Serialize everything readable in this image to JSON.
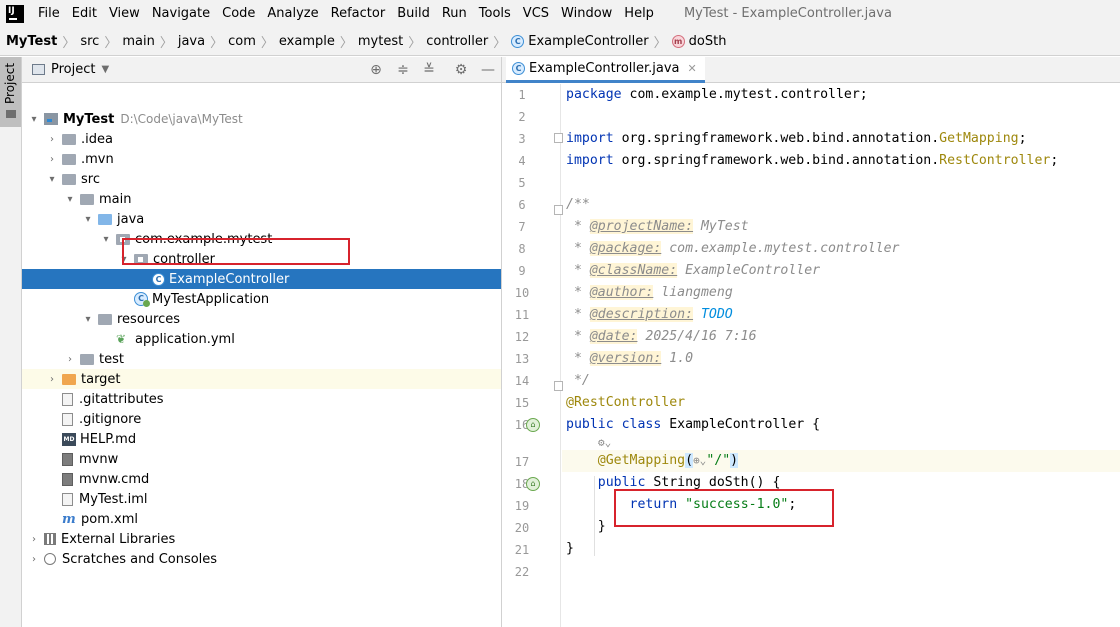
{
  "menubar": {
    "logo_text": "IJ",
    "items": [
      "File",
      "Edit",
      "View",
      "Navigate",
      "Code",
      "Analyze",
      "Refactor",
      "Build",
      "Run",
      "Tools",
      "VCS",
      "Window",
      "Help"
    ],
    "window_title": "MyTest - ExampleController.java"
  },
  "breadcrumbs": [
    "MyTest",
    "src",
    "main",
    "java",
    "com",
    "example",
    "mytest",
    "controller",
    "ExampleController",
    "doSth"
  ],
  "project_panel": {
    "title": "Project",
    "tree": [
      {
        "label": "MyTest",
        "hint": "D:\\Code\\java\\MyTest"
      },
      {
        "label": ".idea"
      },
      {
        "label": ".mvn"
      },
      {
        "label": "src"
      },
      {
        "label": "main"
      },
      {
        "label": "java"
      },
      {
        "label": "com.example.mytest"
      },
      {
        "label": "controller"
      },
      {
        "label": "ExampleController"
      },
      {
        "label": "MyTestApplication"
      },
      {
        "label": "resources"
      },
      {
        "label": "application.yml"
      },
      {
        "label": "test"
      },
      {
        "label": "target"
      },
      {
        "label": ".gitattributes"
      },
      {
        "label": ".gitignore"
      },
      {
        "label": "HELP.md"
      },
      {
        "label": "mvnw"
      },
      {
        "label": "mvnw.cmd"
      },
      {
        "label": "MyTest.iml"
      },
      {
        "label": "pom.xml"
      },
      {
        "label": "External Libraries"
      },
      {
        "label": "Scratches and Consoles"
      }
    ]
  },
  "editor": {
    "tab_label": "ExampleController.java",
    "line_numbers": [
      "1",
      "2",
      "3",
      "4",
      "5",
      "6",
      "7",
      "8",
      "9",
      "10",
      "11",
      "12",
      "13",
      "14",
      "15",
      "16",
      "17",
      "18",
      "19",
      "20",
      "21",
      "22"
    ],
    "code": {
      "l1_kw": "package",
      "l1_rest": " com.example.mytest.controller;",
      "l3_kw": "import",
      "l3_pkg": " org.springframework.web.bind.annotation.",
      "l3_cls": "GetMapping",
      "l3_end": ";",
      "l4_kw": "import",
      "l4_pkg": " org.springframework.web.bind.annotation.",
      "l4_cls": "RestController",
      "l4_end": ";",
      "l6": "/**",
      "l7_pre": " * ",
      "l7_tag": "@projectName:",
      "l7_val": " MyTest",
      "l8_pre": " * ",
      "l8_tag": "@package:",
      "l8_val": " com.example.mytest.controller",
      "l9_pre": " * ",
      "l9_tag": "@className:",
      "l9_val": " ExampleController",
      "l10_pre": " * ",
      "l10_tag": "@author:",
      "l10_val": " liangmeng",
      "l11_pre": " * ",
      "l11_tag": "@description:",
      "l11_val": " TODO",
      "l12_pre": " * ",
      "l12_tag": "@date:",
      "l12_val": " 2025/4/16 7:16",
      "l13_pre": " * ",
      "l13_tag": "@version:",
      "l13_val": " 1.0",
      "l14": " */",
      "l15": "@RestController",
      "l16_kw": "public class",
      "l16_rest": " ExampleController {",
      "l17_ann": "@GetMapping",
      "l17_open": "(",
      "l17_str": "\"/\"",
      "l17_close": ")",
      "l18_kw": "public",
      "l18_rest": " String doSth() {",
      "l19_kw": "return",
      "l19_str": " \"success-1.0\"",
      "l19_end": ";",
      "l20": "}",
      "l21": "}"
    }
  },
  "colors": {
    "selection": "#2675bf",
    "keyword": "#0033b3",
    "annotation": "#9e880d",
    "string": "#067d17",
    "highlight_box": "#d7232c"
  }
}
